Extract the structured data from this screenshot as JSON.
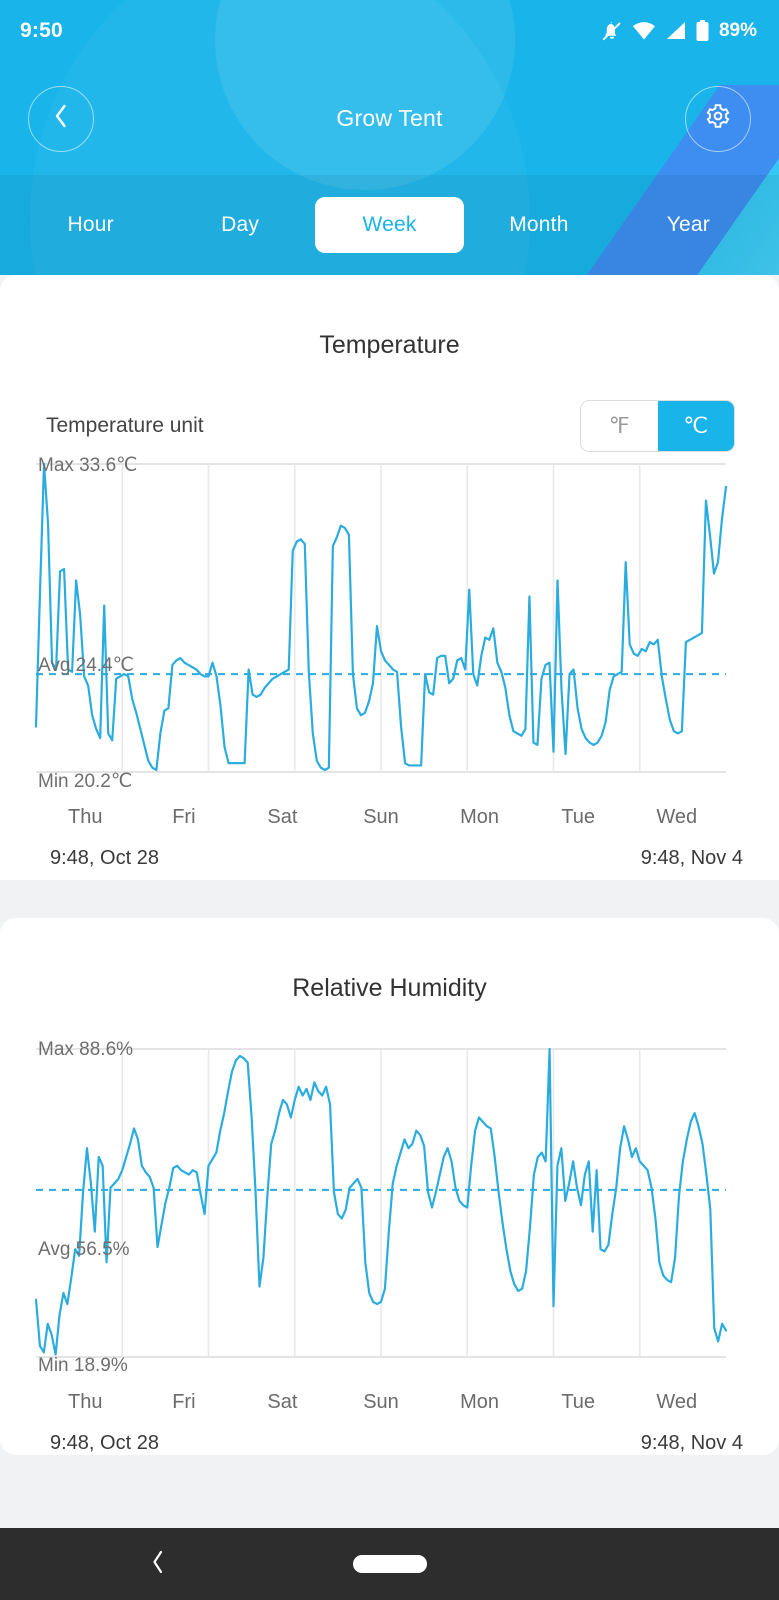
{
  "status_bar": {
    "time": "9:50",
    "battery_pct": "89%",
    "icons": [
      "bell-off-icon",
      "wifi-icon",
      "signal-icon",
      "battery-icon"
    ]
  },
  "nav": {
    "back_icon": "chevron-left-icon",
    "title": "Grow Tent",
    "settings_icon": "gear-icon"
  },
  "tabs": [
    {
      "label": "Hour",
      "active": false
    },
    {
      "label": "Day",
      "active": false
    },
    {
      "label": "Week",
      "active": true
    },
    {
      "label": "Month",
      "active": false
    },
    {
      "label": "Year",
      "active": false
    }
  ],
  "colors": {
    "brand": "#19b4ea",
    "line": "#2bacdf",
    "header_bg": "#19b4ea",
    "page_bg": "#f1f2f3",
    "card_bg": "#ffffff",
    "grid": "#e2e2e2",
    "sysnav_bg": "#2d2d2d"
  },
  "temperature_card": {
    "title": "Temperature",
    "unit_setting_label": "Temperature unit",
    "unit_options": [
      {
        "label": "℉",
        "selected": false
      },
      {
        "label": "℃",
        "selected": true
      }
    ],
    "max_label": "Max 33.6℃",
    "avg_label": "Avg 24.4℃",
    "min_label": "Min 20.2℃",
    "x_ticks": [
      "Thu",
      "Fri",
      "Sat",
      "Sun",
      "Mon",
      "Tue",
      "Wed"
    ],
    "range_start": "9:48,  Oct 28",
    "range_end": "9:48,  Nov 4"
  },
  "humidity_card": {
    "title": "Relative Humidity",
    "max_label": "Max 88.6%",
    "avg_label": "Avg 56.5%",
    "min_label": "Min 18.9%",
    "x_ticks": [
      "Thu",
      "Fri",
      "Sat",
      "Sun",
      "Mon",
      "Tue",
      "Wed"
    ],
    "range_start": "9:48,  Oct 28",
    "range_end": "9:48,  Nov 4"
  },
  "system_nav": {
    "back_icon": "chevron-left-icon",
    "home_pill": "home-pill"
  },
  "chart_data": [
    {
      "id": "temperature",
      "type": "line",
      "title": "Temperature",
      "xlabel": "",
      "ylabel": "℃",
      "unit": "℃",
      "ylim": [
        20.2,
        33.6
      ],
      "max": 33.6,
      "avg": 24.4,
      "min": 20.2,
      "grid": true,
      "legend": "none",
      "x_tick_labels": [
        "Thu",
        "Fri",
        "Sat",
        "Sun",
        "Mon",
        "Tue",
        "Wed"
      ],
      "x_range": [
        "9:48, Oct 28",
        "9:48, Nov 4"
      ],
      "avg_line": 24.4,
      "values": [
        22.1,
        28.0,
        33.6,
        31.0,
        24.9,
        24.6,
        28.9,
        29.0,
        24.6,
        24.5,
        28.5,
        27.0,
        24.3,
        23.9,
        22.6,
        22.0,
        21.6,
        27.4,
        21.8,
        21.5,
        24.2,
        24.3,
        24.4,
        24.3,
        23.3,
        22.7,
        22.0,
        21.3,
        20.6,
        20.3,
        20.2,
        21.8,
        22.8,
        22.9,
        24.8,
        25.0,
        25.1,
        24.9,
        24.8,
        24.7,
        24.6,
        24.4,
        24.3,
        24.3,
        24.9,
        24.3,
        23.0,
        21.2,
        20.5,
        20.5,
        20.5,
        20.5,
        20.5,
        24.6,
        23.5,
        23.4,
        23.5,
        23.8,
        24.0,
        24.2,
        24.3,
        24.4,
        24.5,
        24.6,
        29.8,
        30.2,
        30.3,
        30.1,
        24.5,
        21.8,
        20.6,
        20.3,
        20.2,
        20.3,
        30.0,
        30.4,
        30.9,
        30.8,
        30.5,
        24.4,
        22.9,
        22.6,
        22.7,
        23.2,
        24.0,
        26.5,
        25.4,
        25.0,
        24.8,
        24.6,
        24.5,
        22.1,
        20.5,
        20.4,
        20.4,
        20.4,
        20.4,
        24.4,
        23.6,
        23.5,
        25.1,
        25.2,
        25.2,
        24.0,
        24.2,
        25.0,
        25.1,
        24.6,
        28.1,
        24.4,
        23.9,
        25.2,
        26.0,
        25.9,
        26.4,
        24.9,
        24.5,
        23.8,
        22.6,
        21.9,
        21.8,
        21.7,
        22.0,
        27.8,
        21.4,
        21.3,
        24.2,
        24.8,
        24.9,
        21.0,
        28.5,
        23.7,
        20.9,
        24.4,
        24.6,
        22.9,
        22.0,
        21.6,
        21.4,
        21.3,
        21.4,
        21.7,
        22.3,
        23.7,
        24.3,
        24.4,
        24.5,
        29.3,
        25.7,
        25.3,
        25.2,
        25.5,
        25.4,
        25.8,
        25.7,
        25.9,
        24.3,
        23.3,
        22.4,
        21.9,
        21.8,
        21.9,
        25.8,
        25.9,
        26.0,
        26.1,
        26.2,
        32.0,
        30.5,
        28.8,
        29.3,
        31.2,
        32.6
      ]
    },
    {
      "id": "relative_humidity",
      "type": "line",
      "title": "Relative Humidity",
      "xlabel": "",
      "ylabel": "%",
      "unit": "%",
      "ylim": [
        18.9,
        88.6
      ],
      "max": 88.6,
      "avg": 56.5,
      "min": 18.9,
      "grid": true,
      "legend": "none",
      "x_tick_labels": [
        "Thu",
        "Fri",
        "Sat",
        "Sun",
        "Mon",
        "Tue",
        "Wed"
      ],
      "x_range": [
        "9:48, Oct 28",
        "9:48, Nov 4"
      ],
      "avg_line": 56.5,
      "values": [
        31.5,
        21.0,
        19.5,
        26.0,
        23.5,
        19.0,
        28.0,
        33.0,
        30.5,
        36.5,
        43.0,
        41.5,
        56.0,
        66.0,
        58.0,
        47.0,
        64.0,
        62.0,
        40.0,
        57.0,
        58.0,
        59.0,
        61.0,
        64.0,
        67.0,
        70.5,
        68.0,
        62.0,
        60.5,
        59.5,
        57.0,
        43.5,
        48.5,
        53.5,
        57.0,
        61.5,
        62.0,
        61.0,
        60.5,
        60.0,
        61.0,
        60.5,
        55.5,
        51.0,
        62.0,
        63.5,
        65.0,
        70.0,
        74.0,
        79.0,
        83.5,
        86.0,
        87.0,
        86.5,
        85.5,
        73.0,
        56.0,
        34.5,
        41.0,
        55.0,
        67.0,
        70.0,
        74.0,
        77.0,
        76.0,
        73.0,
        77.0,
        80.0,
        78.0,
        79.5,
        77.0,
        81.0,
        79.0,
        78.0,
        80.0,
        76.0,
        56.0,
        51.0,
        50.0,
        52.0,
        57.0,
        58.0,
        59.0,
        57.0,
        40.0,
        33.0,
        31.0,
        30.5,
        31.0,
        34.0,
        47.0,
        58.0,
        62.0,
        65.0,
        68.0,
        66.0,
        67.0,
        70.0,
        69.0,
        66.5,
        56.0,
        52.5,
        56.0,
        60.0,
        64.0,
        66.0,
        63.0,
        57.0,
        54.0,
        53.0,
        52.5,
        62.0,
        70.0,
        73.0,
        72.0,
        71.0,
        70.5,
        64.0,
        56.0,
        49.0,
        43.0,
        38.0,
        35.0,
        33.5,
        34.0,
        38.0,
        48.0,
        60.0,
        64.0,
        65.0,
        63.0,
        88.6,
        30.0,
        62.0,
        66.0,
        54.0,
        58.0,
        63.0,
        57.0,
        53.0,
        60.0,
        63.0,
        47.0,
        61.0,
        43.0,
        42.5,
        44.0,
        51.0,
        57.0,
        66.0,
        71.0,
        68.0,
        64.0,
        66.0,
        63.0,
        62.0,
        61.0,
        57.0,
        50.0,
        40.0,
        37.0,
        36.0,
        35.5,
        41.0,
        55.0,
        63.0,
        68.0,
        72.0,
        74.0,
        71.0,
        67.0,
        60.0,
        52.0,
        25.0,
        22.0,
        26.0,
        24.5
      ]
    }
  ]
}
